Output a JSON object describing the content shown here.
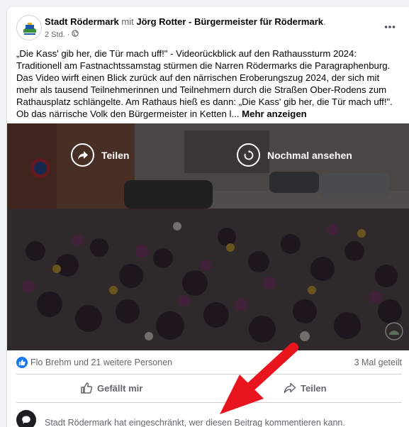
{
  "post": {
    "page_name": "Stadt Rödermark",
    "connector": "mit",
    "tagged_name": "Jörg Rotter - Bürgermeister für Rödermark",
    "tagged_suffix": ".",
    "timestamp": "2 Std.",
    "separator": "·",
    "audience_icon": "globe-icon",
    "menu_icon": "more-options-icon",
    "body_text": "„Die Kass' gib her, die Tür mach uff!\" - Videorückblick auf den Rathaussturm 2024: Traditionell am Fastnachtssamstag stürmen die Narren Rödermarks die Paragraphenburg. Das Video wirft einen Blick zurück auf den närrischen Eroberungszug 2024, der sich mit mehr als tausend Teilnehmerinnen und Teilnehmern durch die Straßen Ober-Rodens zum Rathausplatz schlängelte. Am Rathaus hieß es dann: „Die Kass' gib her, die Tür mach uff!\". Ob das närrische Volk den Bürgermeister in Ketten l...",
    "see_more": "Mehr anzeigen"
  },
  "video": {
    "share_label": "Teilen",
    "replay_label": "Nochmal ansehen"
  },
  "engagement": {
    "reaction_icon": "like-icon",
    "reaction_text": "Flo Brehm und 21 weitere Personen",
    "shares_text": "3 Mal geteilt"
  },
  "actions": {
    "like_label": "Gefällt mir",
    "share_label": "Teilen"
  },
  "comments": {
    "restricted_text": "Stadt Rödermark hat eingeschränkt, wer diesen Beitrag kommentieren kann."
  },
  "colors": {
    "accent": "#1877f2",
    "annotation_arrow": "#e8141e",
    "secondary_text": "#65676b"
  }
}
